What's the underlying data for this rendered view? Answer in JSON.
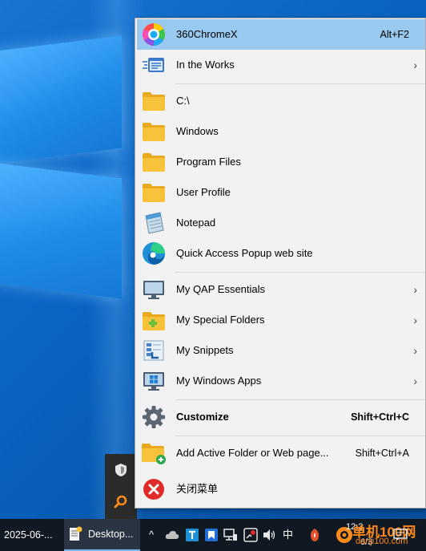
{
  "menu": {
    "items": [
      {
        "label": "360ChromeX",
        "shortcut": "Alt+F2",
        "icon": "chrome-360-icon",
        "highlighted": true
      },
      {
        "label": "In the Works",
        "submenu": true,
        "icon": "in-the-works-icon"
      },
      {
        "label": "C:\\",
        "icon": "folder-icon"
      },
      {
        "label": "Windows",
        "icon": "folder-icon"
      },
      {
        "label": "Program Files",
        "icon": "folder-icon"
      },
      {
        "label": "User Profile",
        "icon": "folder-icon"
      },
      {
        "label": "Notepad",
        "icon": "notepad-icon"
      },
      {
        "label": "Quick Access Popup web site",
        "icon": "edge-icon"
      },
      {
        "label": "My QAP Essentials",
        "submenu": true,
        "icon": "monitor-icon"
      },
      {
        "label": "My Special Folders",
        "submenu": true,
        "icon": "special-folder-icon"
      },
      {
        "label": "My Snippets",
        "submenu": true,
        "icon": "snippets-icon"
      },
      {
        "label": "My Windows Apps",
        "submenu": true,
        "icon": "windows-apps-icon"
      },
      {
        "label": "Customize",
        "shortcut": "Shift+Ctrl+C",
        "bold": true,
        "icon": "gear-icon"
      },
      {
        "label": "Add Active Folder or Web page...",
        "shortcut": "Shift+Ctrl+A",
        "icon": "add-folder-icon"
      },
      {
        "label": "关闭菜单",
        "icon": "close-red-icon"
      }
    ],
    "arrow": "›"
  },
  "taskbar": {
    "date": "2025-06-...",
    "app_label": "Desktop...",
    "chevron": "^",
    "ime": "中",
    "time": "12:3",
    "date_short": "6/3"
  },
  "watermark": {
    "big": "单机100网",
    "small": "danji100.com"
  },
  "colors": {
    "highlight": "#99c9ef",
    "folder": "#f8c33a",
    "accent": "#ff8a1c"
  }
}
